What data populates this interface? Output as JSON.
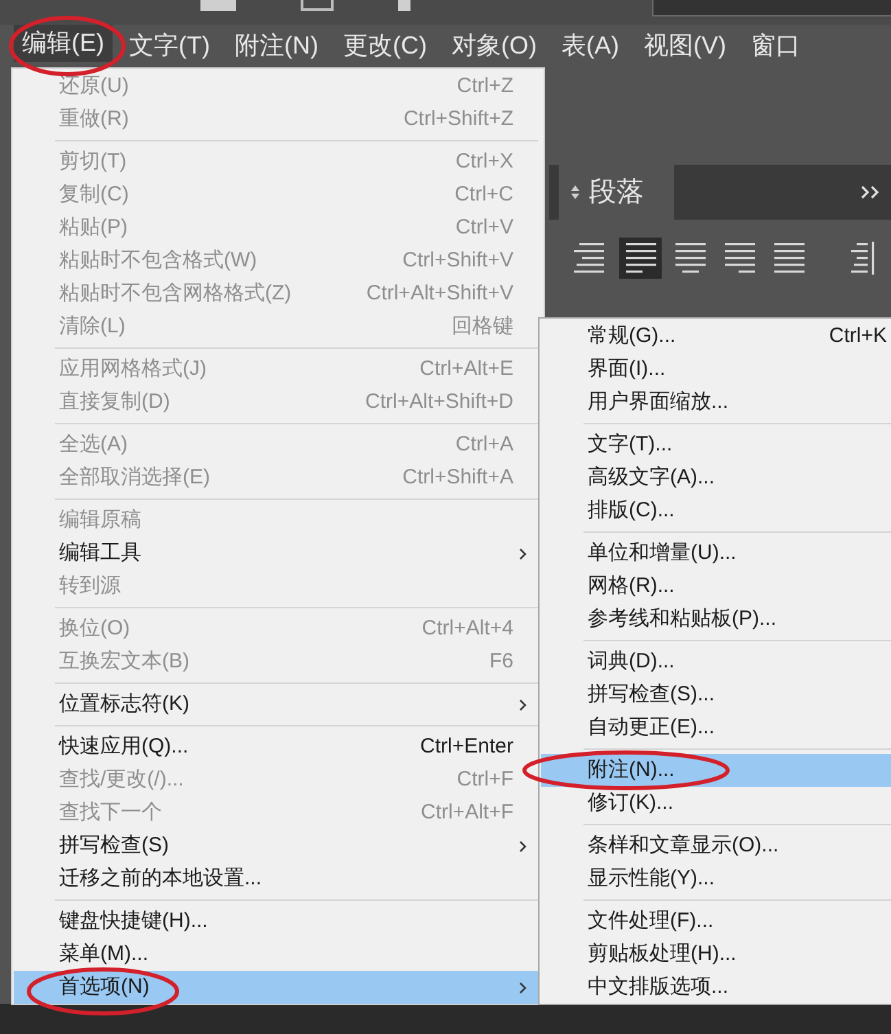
{
  "menu_bar": {
    "items": [
      {
        "label": "编辑(E)",
        "selected": true,
        "circled": true
      },
      {
        "label": "文字(T)",
        "selected": false,
        "circled": false
      },
      {
        "label": "附注(N)",
        "selected": false,
        "circled": false
      },
      {
        "label": "更改(C)",
        "selected": false,
        "circled": false
      },
      {
        "label": "对象(O)",
        "selected": false,
        "circled": false
      },
      {
        "label": "表(A)",
        "selected": false,
        "circled": false
      },
      {
        "label": "视图(V)",
        "selected": false,
        "circled": false
      },
      {
        "label": "窗口",
        "selected": false,
        "circled": false
      }
    ]
  },
  "paragraph_panel": {
    "tab": "段落",
    "align_buttons": [
      {
        "selected": false
      },
      {
        "selected": true
      },
      {
        "selected": false
      },
      {
        "selected": false
      },
      {
        "selected": false
      },
      {
        "selected": false
      }
    ]
  },
  "edit_menu": {
    "groups": [
      {
        "items": [
          {
            "label": "还原(U)",
            "shortcut": "Ctrl+Z",
            "disabled": true
          },
          {
            "label": "重做(R)",
            "shortcut": "Ctrl+Shift+Z",
            "disabled": true
          }
        ]
      },
      {
        "items": [
          {
            "label": "剪切(T)",
            "shortcut": "Ctrl+X",
            "disabled": true
          },
          {
            "label": "复制(C)",
            "shortcut": "Ctrl+C",
            "disabled": true
          },
          {
            "label": "粘贴(P)",
            "shortcut": "Ctrl+V",
            "disabled": true
          },
          {
            "label": "粘贴时不包含格式(W)",
            "shortcut": "Ctrl+Shift+V",
            "disabled": true
          },
          {
            "label": "粘贴时不包含网格格式(Z)",
            "shortcut": "Ctrl+Alt+Shift+V",
            "disabled": true
          },
          {
            "label": "清除(L)",
            "shortcut": "回格键",
            "disabled": true
          }
        ]
      },
      {
        "items": [
          {
            "label": "应用网格格式(J)",
            "shortcut": "Ctrl+Alt+E",
            "disabled": true
          },
          {
            "label": "直接复制(D)",
            "shortcut": "Ctrl+Alt+Shift+D",
            "disabled": true
          }
        ]
      },
      {
        "items": [
          {
            "label": "全选(A)",
            "shortcut": "Ctrl+A",
            "disabled": true
          },
          {
            "label": "全部取消选择(E)",
            "shortcut": "Ctrl+Shift+A",
            "disabled": true
          }
        ]
      },
      {
        "items": [
          {
            "label": "编辑原稿",
            "disabled": true
          },
          {
            "label": "编辑工具",
            "disabled": false,
            "submenu": true
          },
          {
            "label": "转到源",
            "disabled": true
          }
        ]
      },
      {
        "items": [
          {
            "label": "换位(O)",
            "shortcut": "Ctrl+Alt+4",
            "disabled": true
          },
          {
            "label": "互换宏文本(B)",
            "shortcut": "F6",
            "disabled": true
          }
        ]
      },
      {
        "items": [
          {
            "label": "位置标志符(K)",
            "disabled": false,
            "submenu": true
          }
        ]
      },
      {
        "items": [
          {
            "label": "快速应用(Q)...",
            "shortcut": "Ctrl+Enter",
            "disabled": false
          },
          {
            "label": "查找/更改(/)...",
            "shortcut": "Ctrl+F",
            "disabled": true
          },
          {
            "label": "查找下一个",
            "shortcut": "Ctrl+Alt+F",
            "disabled": true
          },
          {
            "label": "拼写检查(S)",
            "disabled": false,
            "submenu": true
          },
          {
            "label": "迁移之前的本地设置...",
            "disabled": false
          }
        ]
      },
      {
        "items": [
          {
            "label": "键盘快捷键(H)...",
            "disabled": false
          },
          {
            "label": "菜单(M)...",
            "disabled": false
          },
          {
            "label": "首选项(N)",
            "disabled": false,
            "submenu": true,
            "selected": true,
            "circled": true
          }
        ]
      }
    ]
  },
  "preferences_submenu": {
    "groups": [
      {
        "items": [
          {
            "label": "常规(G)...",
            "shortcut": "Ctrl+K"
          },
          {
            "label": "界面(I)..."
          },
          {
            "label": "用户界面缩放..."
          }
        ]
      },
      {
        "items": [
          {
            "label": "文字(T)..."
          },
          {
            "label": "高级文字(A)..."
          },
          {
            "label": "排版(C)..."
          }
        ]
      },
      {
        "items": [
          {
            "label": "单位和增量(U)..."
          },
          {
            "label": "网格(R)..."
          },
          {
            "label": "参考线和粘贴板(P)..."
          }
        ]
      },
      {
        "items": [
          {
            "label": "词典(D)..."
          },
          {
            "label": "拼写检查(S)..."
          },
          {
            "label": "自动更正(E)..."
          }
        ]
      },
      {
        "items": [
          {
            "label": "附注(N)...",
            "selected": true,
            "circled": true
          },
          {
            "label": "修订(K)..."
          }
        ]
      },
      {
        "items": [
          {
            "label": "条样和文章显示(O)..."
          },
          {
            "label": "显示性能(Y)..."
          }
        ]
      },
      {
        "items": [
          {
            "label": "文件处理(F)..."
          },
          {
            "label": "剪贴板处理(H)..."
          },
          {
            "label": "中文排版选项..."
          }
        ]
      }
    ]
  }
}
